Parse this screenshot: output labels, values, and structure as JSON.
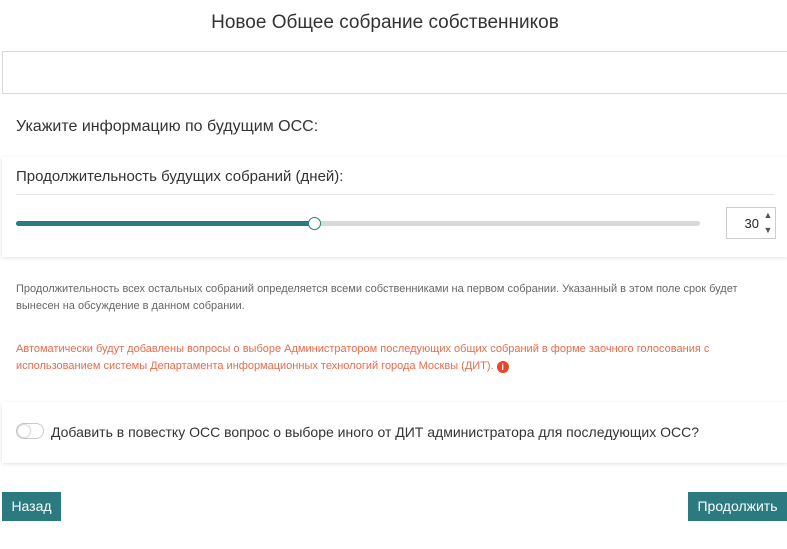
{
  "page": {
    "title": "Новое Общее собрание собственников"
  },
  "top_field": {
    "value": ""
  },
  "section": {
    "heading": "Укажите информацию по будущим ОСС:"
  },
  "duration": {
    "label": "Продолжительность будущих собраний (дней):",
    "value": "30",
    "slider_fraction": 0.435,
    "spin_up_glyph": "▲",
    "spin_down_glyph": "▼"
  },
  "info": {
    "text": "Продолжительность всех остальных собраний определяется всеми собственниками на первом собрании. Указанный в этом поле срок будет вынесен на обсуждение в данном собрании."
  },
  "warning": {
    "text": "Автоматически будут добавлены вопросы о выборе Администратором последующих общих собраний в форме заочного голосования с использованием системы Департамента информационных технологий города Москвы (ДИТ).",
    "icon": "info-icon",
    "icon_glyph": "i"
  },
  "toggle": {
    "label": "Добавить в повестку ОСС вопрос о выборе иного от ДИТ администратора для последующих ОСС?",
    "checked": false
  },
  "buttons": {
    "back_label": "Назад",
    "next_label": "Продолжить"
  },
  "colors": {
    "accent": "#2a7a7f",
    "warning": "#e86b4a",
    "warning_icon": "#e8452a"
  }
}
